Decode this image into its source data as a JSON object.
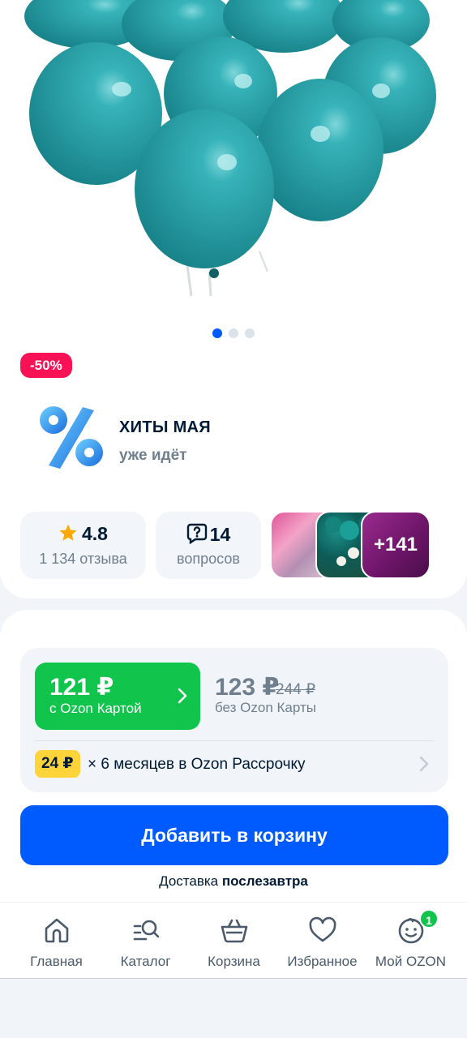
{
  "gallery": {
    "dots": 3,
    "active_dot": 0,
    "balloon_color": "#2aa8ae"
  },
  "discount_badge": "-50%",
  "promo": {
    "title": "ХИТЫ МАЯ",
    "subtitle": "уже идёт"
  },
  "rating": {
    "value": "4.8",
    "reviews": "1 134 отзыва"
  },
  "questions": {
    "count": "14",
    "label": "вопросов"
  },
  "photos": {
    "more": "+141"
  },
  "price": {
    "ozon_card_price": "121 ₽",
    "ozon_card_label": "с Ozon Картой",
    "regular_price": "123 ₽",
    "old_price": "244 ₽",
    "regular_label": "без Ozon Карты",
    "installment_badge": "24 ₽",
    "installment_text": "× 6 месяцев в Ozon Рассрочку"
  },
  "actions": {
    "add_to_cart": "Добавить в корзину"
  },
  "delivery": {
    "prefix": "Доставка",
    "when": "послезавтра"
  },
  "nav": {
    "items": [
      {
        "label": "Главная"
      },
      {
        "label": "Каталог"
      },
      {
        "label": "Корзина"
      },
      {
        "label": "Избранное"
      },
      {
        "label": "Мой OZON"
      }
    ],
    "badge": "1"
  },
  "colors": {
    "brand_blue": "#005bff",
    "ozon_green": "#10c44c",
    "discount_pink": "#f91155",
    "installment_yellow": "#ffd43a"
  }
}
